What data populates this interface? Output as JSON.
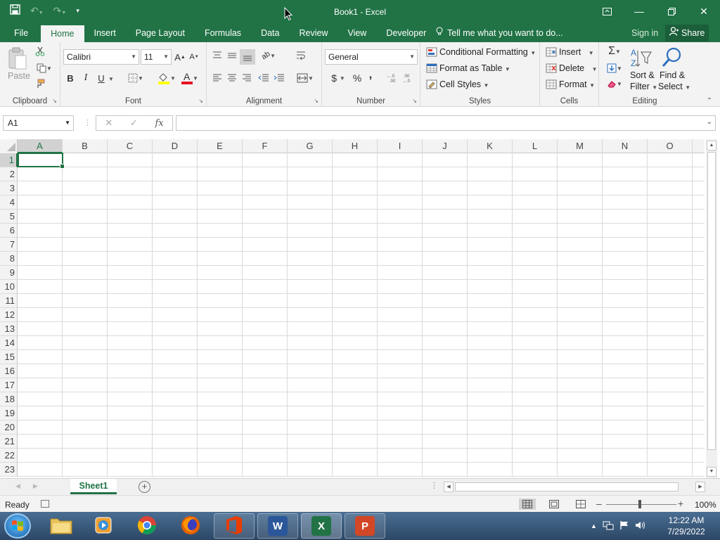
{
  "window": {
    "title": "Book1 - Excel",
    "qat_icons": [
      "save-icon",
      "undo-icon",
      "redo-icon",
      "customize-qat-icon"
    ]
  },
  "menu": {
    "tabs": [
      "File",
      "Home",
      "Insert",
      "Page Layout",
      "Formulas",
      "Data",
      "Review",
      "View",
      "Developer"
    ],
    "active_tab": "Home",
    "tell_me": "Tell me what you want to do...",
    "sign_in": "Sign in",
    "share": "Share"
  },
  "ribbon": {
    "clipboard": {
      "label": "Clipboard",
      "paste": "Paste"
    },
    "font": {
      "label": "Font",
      "name": "Calibri",
      "size": "11",
      "bold": "B",
      "italic": "I",
      "underline": "U",
      "grow": "A",
      "shrink": "A",
      "font_color_letter": "A"
    },
    "alignment": {
      "label": "Alignment"
    },
    "number": {
      "label": "Number",
      "format": "General",
      "currency": "$",
      "percent": "%",
      "comma": ","
    },
    "styles": {
      "label": "Styles",
      "conditional": "Conditional Formatting",
      "format_table": "Format as Table",
      "cell_styles": "Cell Styles"
    },
    "cells": {
      "label": "Cells",
      "insert": "Insert",
      "delete": "Delete",
      "format": "Format"
    },
    "editing": {
      "label": "Editing",
      "sort_1": "Sort &",
      "sort_2": "Filter",
      "find_1": "Find &",
      "find_2": "Select"
    }
  },
  "formula_bar": {
    "name_box": "A1",
    "fx": "fx",
    "value": ""
  },
  "grid": {
    "columns": [
      "A",
      "B",
      "C",
      "D",
      "E",
      "F",
      "G",
      "H",
      "I",
      "J",
      "K",
      "L",
      "M",
      "N",
      "O"
    ],
    "rows": [
      "1",
      "2",
      "3",
      "4",
      "5",
      "6",
      "7",
      "8",
      "9",
      "10",
      "11",
      "12",
      "13",
      "14",
      "15",
      "16",
      "17",
      "18",
      "19",
      "20",
      "21",
      "22",
      "23"
    ],
    "active_cell": "A1"
  },
  "sheets": {
    "tabs": [
      "Sheet1"
    ],
    "active": "Sheet1"
  },
  "status": {
    "ready": "Ready",
    "zoom": "100%"
  },
  "taskbar": {
    "apps": [
      "windows-explorer",
      "media-player",
      "chrome",
      "firefox",
      "office",
      "word",
      "excel",
      "powerpoint"
    ],
    "word_letter": "W",
    "excel_letter": "X",
    "ppt_letter": "P",
    "time": "12:22 AM",
    "date": "7/29/2022"
  },
  "colors": {
    "excel_green": "#217346",
    "taskbar": "#2c4766"
  }
}
